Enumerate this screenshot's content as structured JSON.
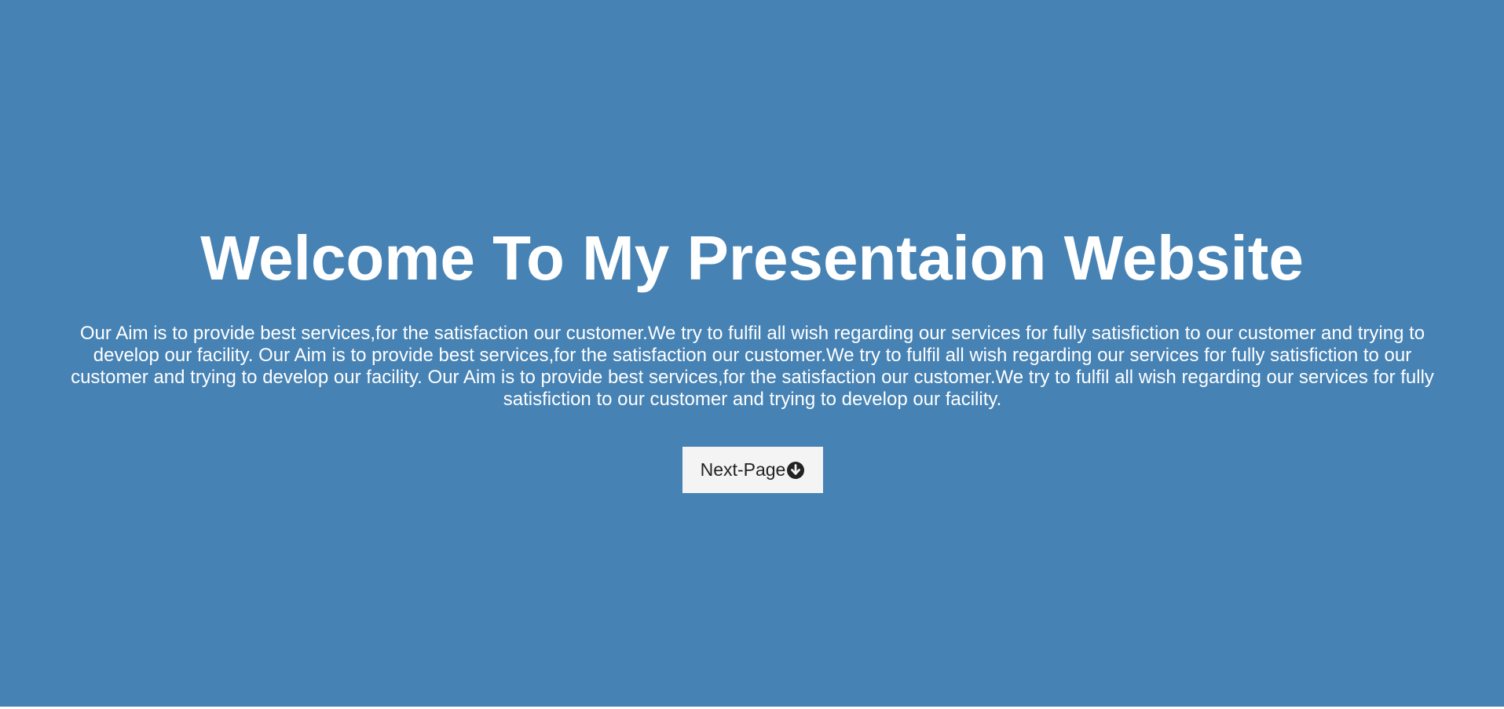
{
  "hero": {
    "title": "Welcome To My Presentaion Website",
    "text": "Our Aim is to provide best services,for the satisfaction our customer.We try to fulfil all wish regarding our services for fully satisfiction to our customer and trying to develop our facility. Our Aim is to provide best services,for the satisfaction our customer.We try to fulfil all wish regarding our services for fully satisfiction to our customer and trying to develop our facility. Our Aim is to provide best services,for the satisfaction our customer.We try to fulfil all wish regarding our services for fully satisfiction to our customer and trying to develop our facility.",
    "background_color": "#4682b4",
    "text_color": "#ffffff"
  },
  "next_button": {
    "label": "Next-Page",
    "icon": "arrow-circle-down-icon",
    "background_color": "#f4f4f4"
  }
}
